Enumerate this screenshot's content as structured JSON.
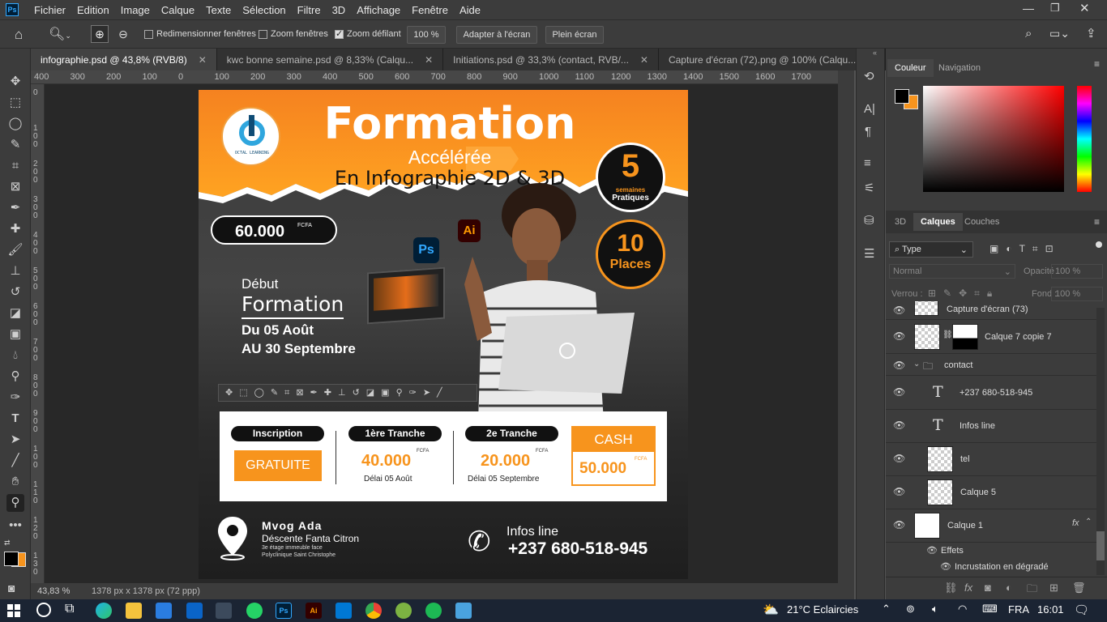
{
  "menu": [
    "Fichier",
    "Edition",
    "Image",
    "Calque",
    "Texte",
    "Sélection",
    "Filtre",
    "3D",
    "Affichage",
    "Fenêtre",
    "Aide"
  ],
  "options": {
    "resize_windows": "Redimensionner fenêtres",
    "zoom_windows": "Zoom fenêtres",
    "scrubby_zoom": "Zoom défilant",
    "zoom_value": "100 %",
    "fit_screen": "Adapter à l'écran",
    "full_screen": "Plein écran"
  },
  "tabs": [
    {
      "label": "infographie.psd @ 43,8% (RVB/8)",
      "active": true
    },
    {
      "label": "kwc bonne semaine.psd @ 8,33% (Calqu...",
      "active": false
    },
    {
      "label": "Initiations.psd @ 33,3% (contact, RVB/...",
      "active": false
    },
    {
      "label": "Capture d'écran (72).png @ 100% (Calqu...",
      "active": false
    }
  ],
  "ruler_top": [
    "400",
    "300",
    "200",
    "100",
    "0",
    "100",
    "200",
    "300",
    "400",
    "500",
    "600",
    "700",
    "800",
    "900",
    "1000",
    "1100",
    "1200",
    "1300",
    "1400",
    "1500",
    "1600",
    "1700"
  ],
  "ruler_left": [
    "0",
    "1 0 0",
    "2 0 0",
    "3 0 0",
    "4 0 0",
    "5 0 0",
    "6 0 0",
    "7 0 0",
    "8 0 0",
    "9 0 0",
    "1 0 0",
    "1 1 0",
    "1 2 0",
    "1 3 0"
  ],
  "status": {
    "zoom": "43,83 %",
    "doc": "1378 px x 1378 px (72 ppp)"
  },
  "artwork": {
    "logo_text": "OCTAL LEARNING",
    "title": "Formation",
    "subtitle1": "Accélérée",
    "subtitle2": "En Infographie 2D & 3D",
    "weeks_num": "5",
    "weeks_label1": "semaines",
    "weeks_label2": "Pratiques",
    "places_num": "10",
    "places_label": "Places",
    "price": "60.000",
    "price_unit": "FCFA",
    "ps": "Ps",
    "ai": "Ai",
    "debut": "Début",
    "formation": "Formation",
    "date1": "Du 05 Août",
    "date2": "AU 30 Septembre",
    "inscription": "Inscription",
    "gratuite": "GRATUITE",
    "tranche1": "1ère Tranche",
    "tranche1_amount": "40.000",
    "tranche1_unit": "FCFA",
    "tranche1_delay": "Délai 05 Août",
    "tranche2": "2e Tranche",
    "tranche2_amount": "20.000",
    "tranche2_unit": "FCFA",
    "tranche2_delay": "Délai 05 Septembre",
    "cash": "CASH",
    "cash_amount": "50.000",
    "cash_unit": "FCFA",
    "address1": "Mvog Ada",
    "address2": "Déscente Fanta Citron",
    "address3": "3e étage immeuble face",
    "address4": "Polyclinique Saint Christophe",
    "infos": "Infos line",
    "phone": "+237 680-518-945"
  },
  "color_panel": {
    "tabs": [
      "Couleur",
      "Navigation"
    ]
  },
  "layers_panel": {
    "tabs": [
      "3D",
      "Calques",
      "Couches"
    ],
    "search": "Type",
    "blend": "Normal",
    "opacity_label": "Opacité :",
    "opacity": "100 %",
    "lock_label": "Verrou :",
    "fill_label": "Fond :",
    "fill": "100 %",
    "layers": [
      {
        "name": "Capture d'écran (73)"
      },
      {
        "name": "Calque 7 copie 7"
      },
      {
        "name": "contact"
      },
      {
        "name": "+237 680-518-945"
      },
      {
        "name": "Infos line"
      },
      {
        "name": "tel"
      },
      {
        "name": "Calque 5"
      },
      {
        "name": "Calque 1"
      }
    ],
    "effects": "Effets",
    "effect1": "Incrustation en dégradé",
    "fx": "fx"
  },
  "taskbar": {
    "weather": "21°C Eclaircies",
    "lang": "FRA",
    "time": "16:01"
  },
  "colors": {
    "orange": "#f7941d",
    "dark": "#1a1a1a",
    "accent": "#f57c00"
  }
}
